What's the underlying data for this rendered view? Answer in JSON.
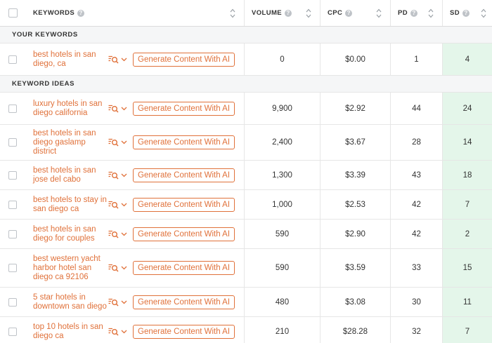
{
  "header": {
    "keywords": "KEYWORDS",
    "volume": "VOLUME",
    "cpc": "CPC",
    "pd": "PD",
    "sd": "SD",
    "info_glyph": "?"
  },
  "sections": {
    "your_keywords": "YOUR KEYWORDS",
    "keyword_ideas": "KEYWORD IDEAS"
  },
  "generate_label": "Generate Content With AI",
  "your_keywords": [
    {
      "keyword": "best hotels in san diego, ca",
      "volume": "0",
      "cpc": "$0.00",
      "pd": "1",
      "sd": "4"
    }
  ],
  "keyword_ideas": [
    {
      "keyword": "luxury hotels in san diego california",
      "volume": "9,900",
      "cpc": "$2.92",
      "pd": "44",
      "sd": "24"
    },
    {
      "keyword": "best hotels in san diego gaslamp district",
      "volume": "2,400",
      "cpc": "$3.67",
      "pd": "28",
      "sd": "14"
    },
    {
      "keyword": "best hotels in san jose del cabo",
      "volume": "1,300",
      "cpc": "$3.39",
      "pd": "43",
      "sd": "18"
    },
    {
      "keyword": "best hotels to stay in san diego ca",
      "volume": "1,000",
      "cpc": "$2.53",
      "pd": "42",
      "sd": "7"
    },
    {
      "keyword": "best hotels in san diego for couples",
      "volume": "590",
      "cpc": "$2.90",
      "pd": "42",
      "sd": "2"
    },
    {
      "keyword": "best western yacht harbor hotel san diego ca 92106",
      "volume": "590",
      "cpc": "$3.59",
      "pd": "33",
      "sd": "15"
    },
    {
      "keyword": "5 star hotels in downtown san diego",
      "volume": "480",
      "cpc": "$3.08",
      "pd": "30",
      "sd": "11"
    },
    {
      "keyword": "top 10 hotels in san diego ca",
      "volume": "210",
      "cpc": "$28.28",
      "pd": "32",
      "sd": "7"
    }
  ],
  "colors": {
    "accent": "#e0713a",
    "sd_bg": "#e4f6ea",
    "section_bg": "#f5f6f7"
  }
}
